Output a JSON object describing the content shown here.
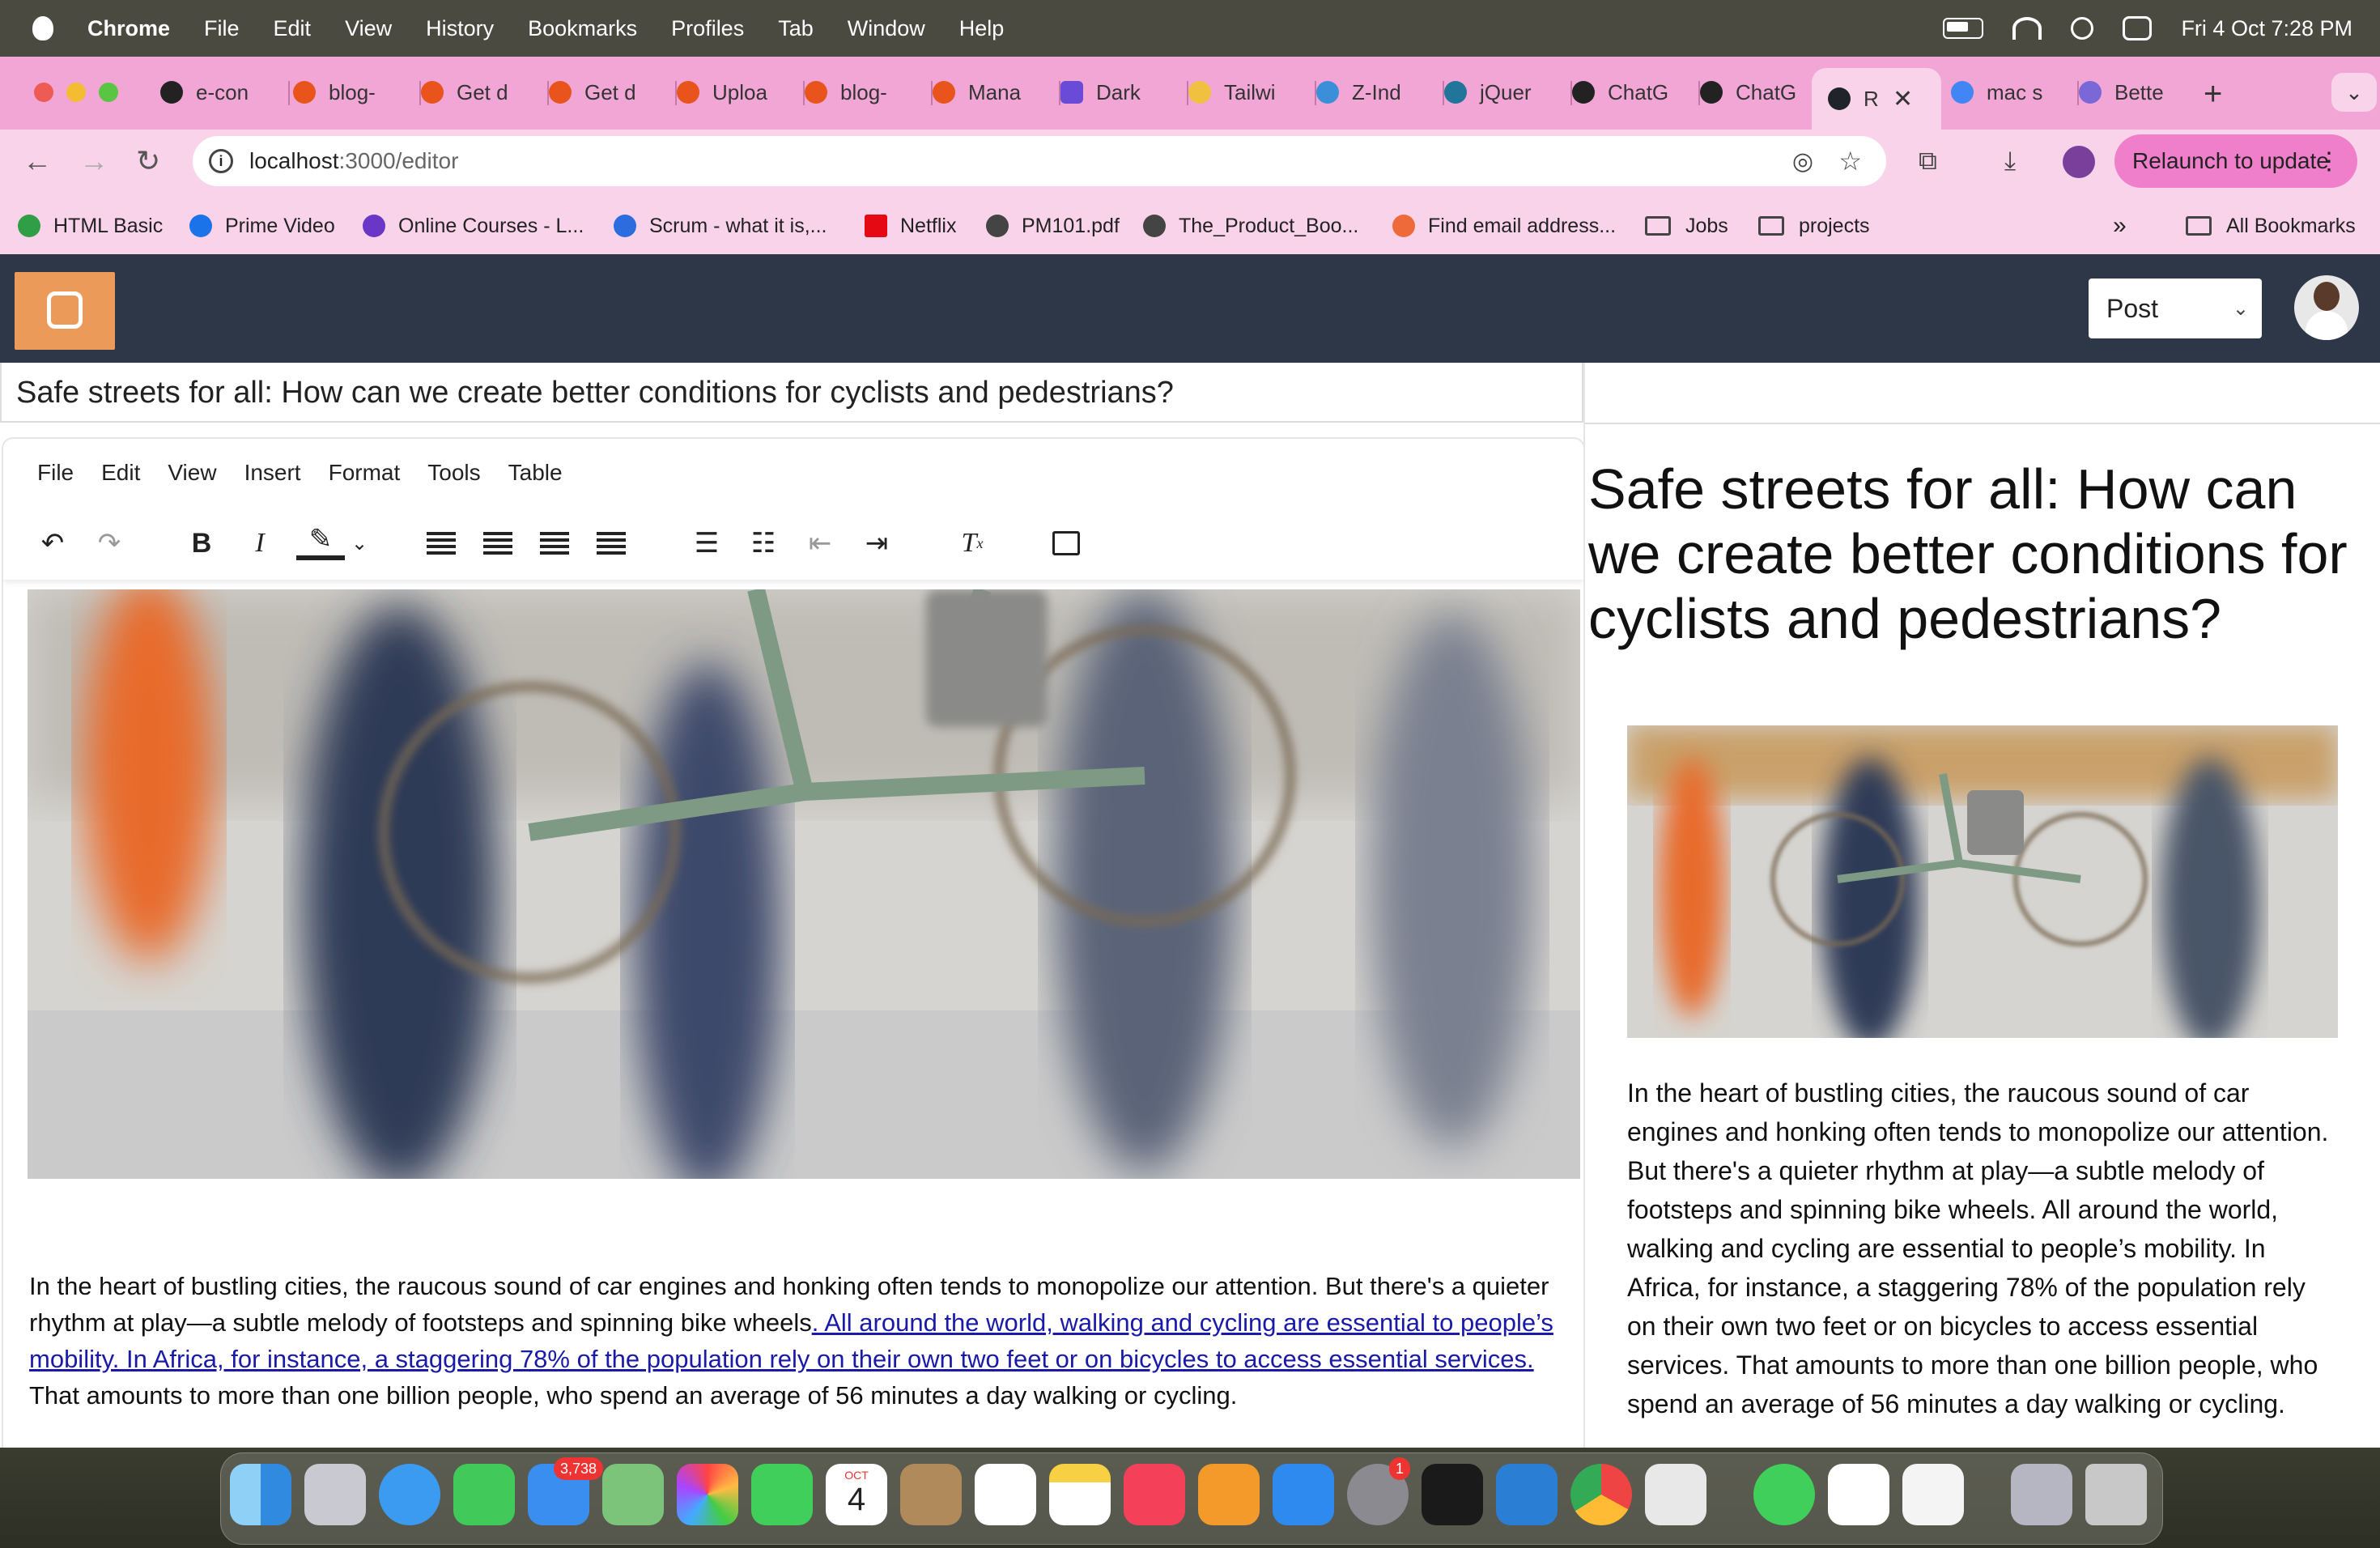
{
  "menubar": {
    "app": "Chrome",
    "items": [
      "File",
      "Edit",
      "View",
      "History",
      "Bookmarks",
      "Profiles",
      "Tab",
      "Window",
      "Help"
    ],
    "datetime": "Fri 4 Oct  7:28 PM"
  },
  "tabs": [
    {
      "label": "e-con",
      "color": "#222222"
    },
    {
      "label": "blog-",
      "color": "#e8541b"
    },
    {
      "label": "Get d",
      "color": "#e8541b"
    },
    {
      "label": "Get d",
      "color": "#e8541b"
    },
    {
      "label": "Uploa",
      "color": "#e8541b"
    },
    {
      "label": "blog-",
      "color": "#e8541b"
    },
    {
      "label": "Mana",
      "color": "#e8541b"
    },
    {
      "label": "Dark",
      "color": "#6a4bd8"
    },
    {
      "label": "Tailwi",
      "color": "#f0c040"
    },
    {
      "label": "Z-Ind",
      "color": "#3a8fd8"
    },
    {
      "label": "jQuer",
      "color": "#21759b"
    },
    {
      "label": "ChatG",
      "color": "#222222"
    },
    {
      "label": "ChatG",
      "color": "#222222"
    },
    {
      "label": "R",
      "color": "#20232a",
      "active": true
    },
    {
      "label": "mac s",
      "color": "#4285f4"
    },
    {
      "label": "Bette",
      "color": "#7a68d8"
    }
  ],
  "omnibox": {
    "host": "localhost",
    "path": ":3000/editor"
  },
  "relaunch_label": "Relaunch to update",
  "bookmarks": [
    {
      "label": "HTML Basic",
      "color": "#2f9e44"
    },
    {
      "label": "Prime Video",
      "color": "#1a73e8"
    },
    {
      "label": "Online Courses - L...",
      "color": "#6a36c8"
    },
    {
      "label": "Scrum - what it is,...",
      "color": "#2d6cdf"
    },
    {
      "label": "Netflix",
      "color": "#e50914"
    },
    {
      "label": "PM101.pdf",
      "color": "#444444"
    },
    {
      "label": "The_Product_Boo...",
      "color": "#444444"
    },
    {
      "label": "Find email address...",
      "color": "#ef6a3a"
    },
    {
      "label": "Jobs",
      "folder": true
    },
    {
      "label": "projects",
      "folder": true
    }
  ],
  "all_bookmarks": "All Bookmarks",
  "app": {
    "post_select": "Post",
    "title": "Safe streets for all: How can we create better conditions for cyclists and pedestrians?",
    "editor_menu": [
      "File",
      "Edit",
      "View",
      "Insert",
      "Format",
      "Tools",
      "Table"
    ],
    "paragraph_start": "In the heart of bustling cities, the raucous sound of car engines and honking often tends to monopolize our attention. But there's a quieter rhythm at play—a subtle melody of footsteps and spinning bike wheels",
    "link_text": ". All around the world, walking and cycling are essential to people’s mobility. In Africa, for instance, a staggering 78% of the population rely on their own two feet or on bicycles to access essential services. ",
    "paragraph_end": "That amounts to more than one billion people, who spend an average of 56 minutes a day walking or cycling.",
    "preview_body": "In the heart of bustling cities, the raucous sound of car engines and honking often tends to monopolize our attention. But there's a quieter rhythm at play—a subtle melody of footsteps and spinning bike wheels. All around the world, walking and cycling are essential to people’s mobility. In Africa, for instance, a staggering 78% of the population rely on their own two feet or on bicycles to access essential services. That amounts to more than one billion people, who spend an average of 56 minutes a day walking or cycling."
  },
  "dock": {
    "apps": [
      "Finder",
      "Launchpad",
      "Safari",
      "Messages",
      "Mail",
      "Maps",
      "Photos",
      "FaceTime",
      "Calendar",
      "Contacts",
      "Reminders",
      "Notes",
      "Music",
      "Pages",
      "App Store",
      "System Settings",
      "Terminal",
      "VS Code",
      "Chrome",
      "Simulator",
      "WhatsApp",
      "MongoDB",
      "TextEdit",
      "Preview",
      "Trash"
    ],
    "mail_badge": "3,738",
    "settings_badge": "1",
    "calendar_month": "OCT",
    "calendar_day": "4"
  },
  "colors": {
    "tabbar": "#f2a6d6",
    "toolbar": "#f9d3ea",
    "appnav": "#2d3748",
    "blogger": "#ec9a5a",
    "link": "#1a1aa8"
  }
}
